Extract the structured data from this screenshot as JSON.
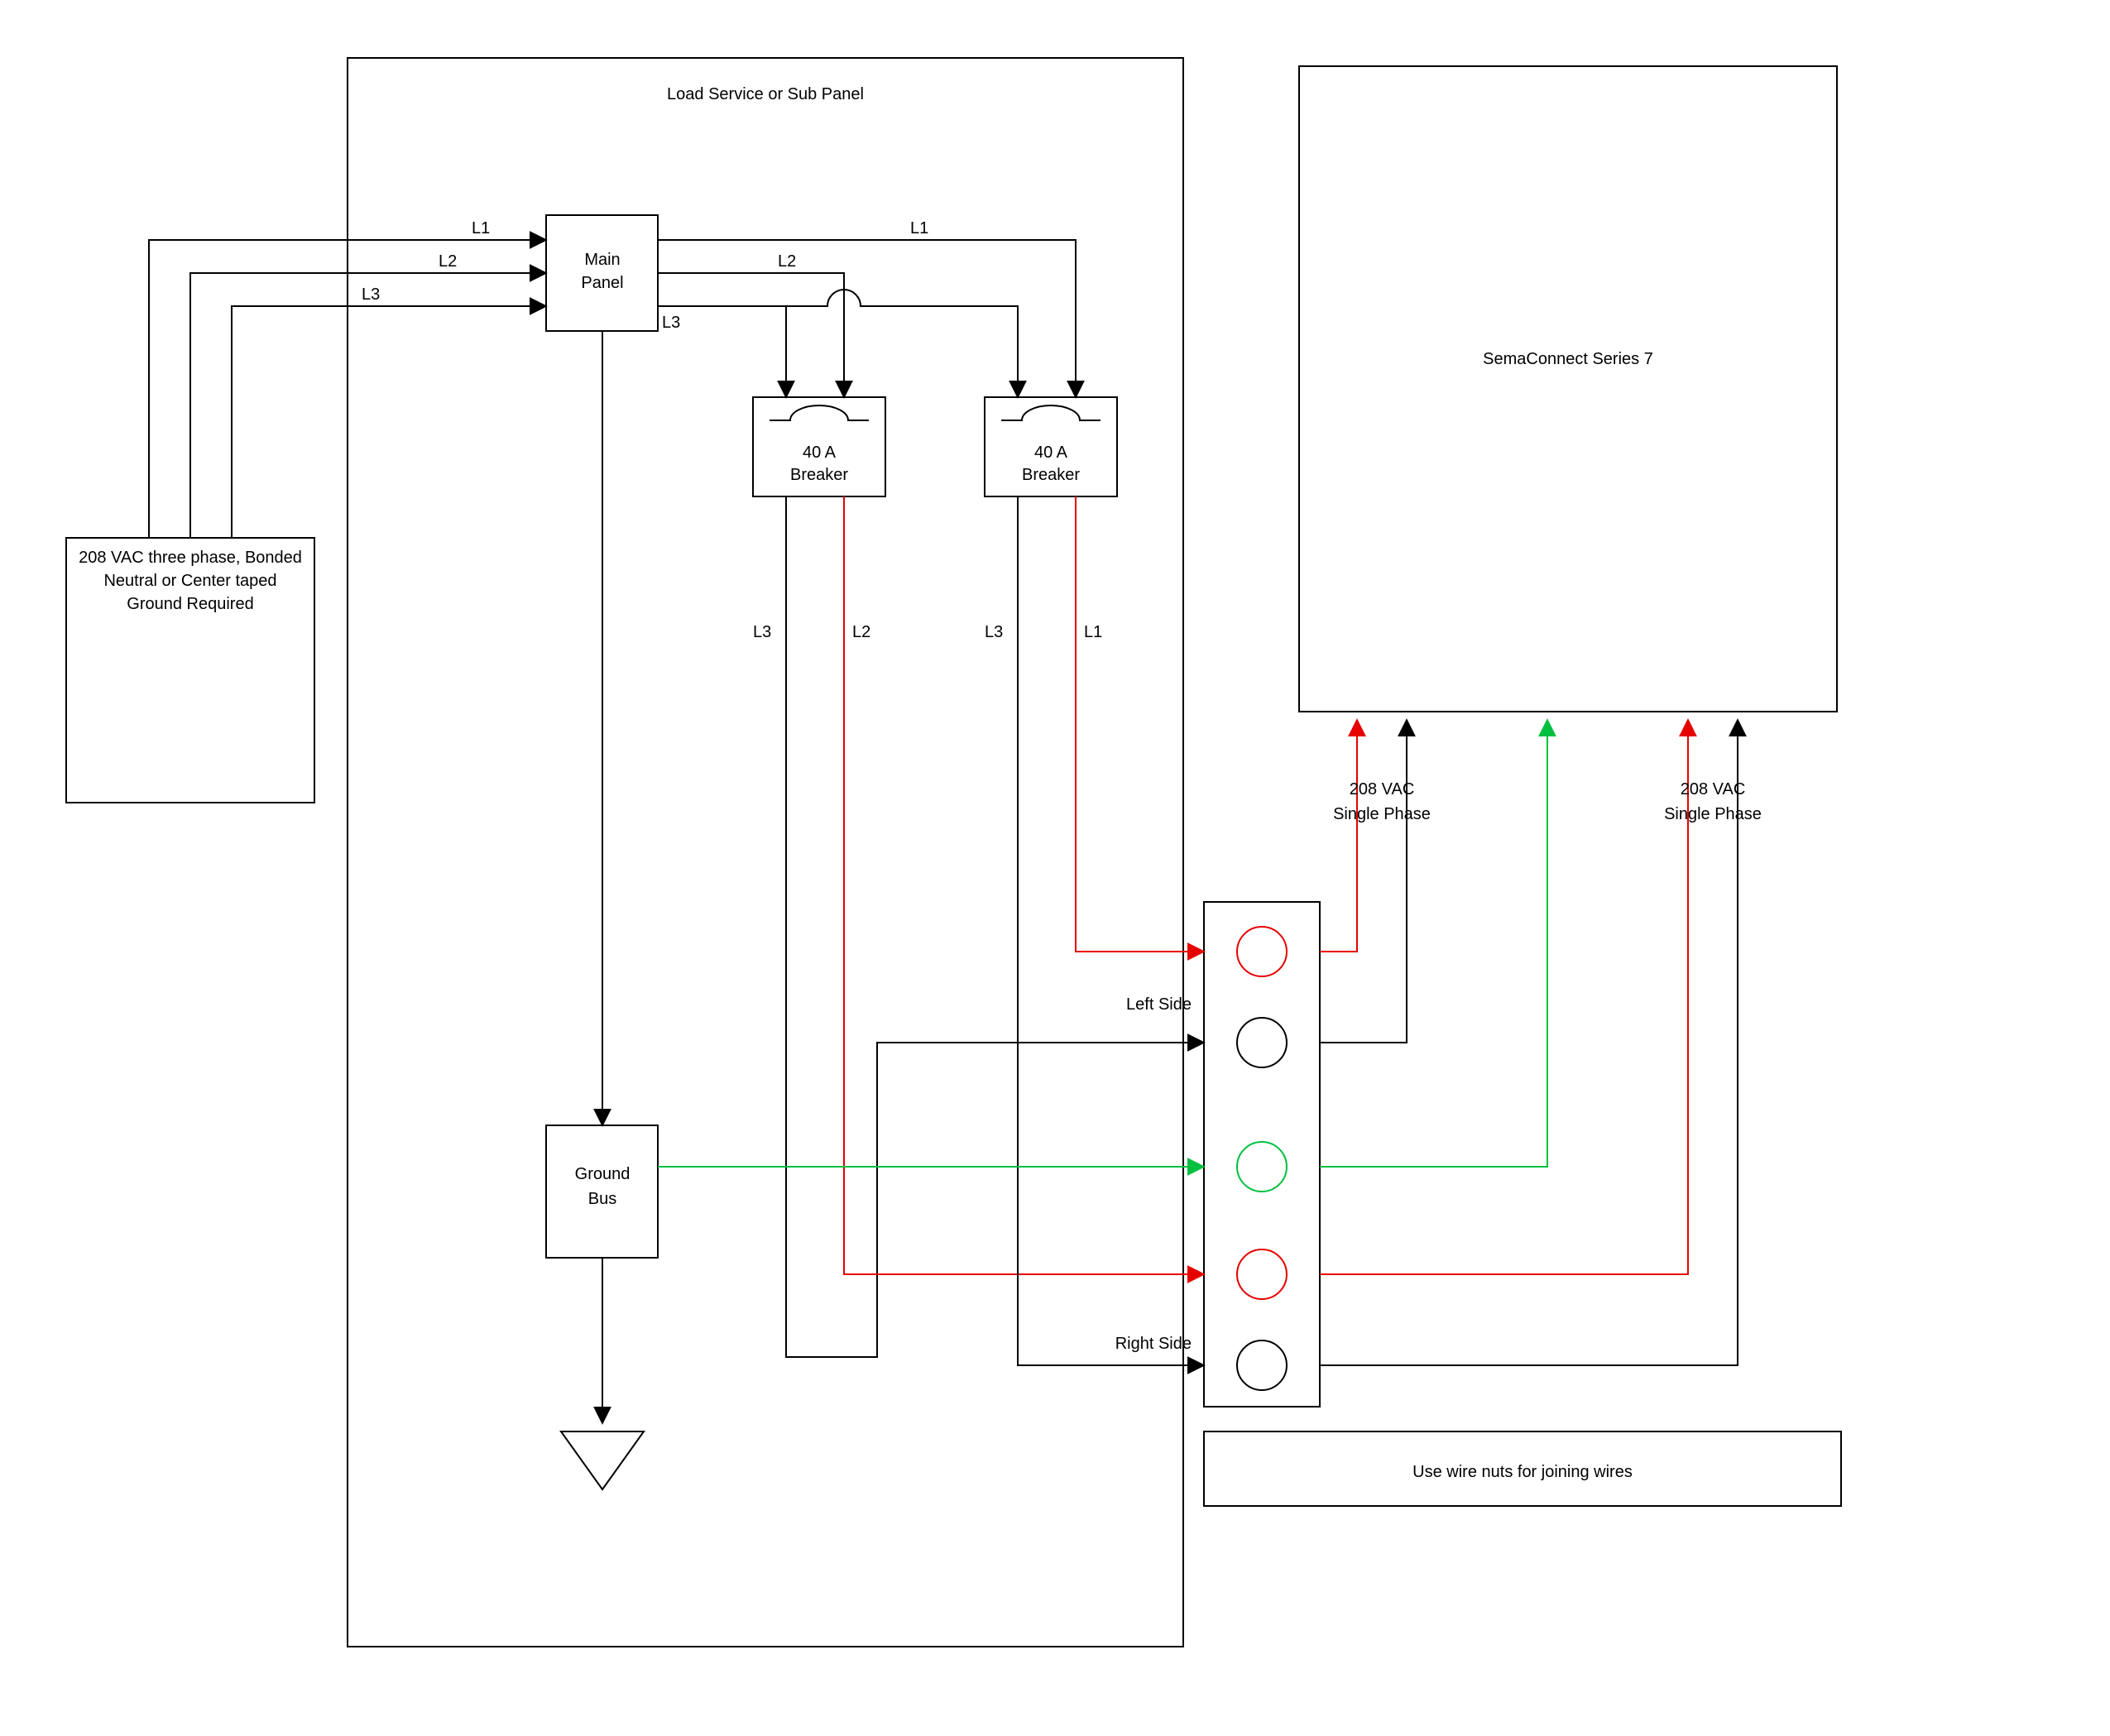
{
  "panel": {
    "title": "Load Service or Sub Panel",
    "main_panel": "Main Panel",
    "ground_bus": "Ground Bus"
  },
  "source": {
    "text": "208 VAC three phase, Bonded Neutral or Center taped Ground Required"
  },
  "lines": {
    "l1": "L1",
    "l2": "L2",
    "l3": "L3"
  },
  "breaker": {
    "label": "40 A Breaker"
  },
  "breaker_out": {
    "left_l3": "L3",
    "left_l2": "L2",
    "right_l3": "L3",
    "right_l1": "L1"
  },
  "sides": {
    "left": "Left Side",
    "right": "Right Side"
  },
  "sema": {
    "title": "SemaConnect Series 7",
    "phase": "208 VAC Single Phase"
  },
  "note": "Use wire nuts for joining wires"
}
